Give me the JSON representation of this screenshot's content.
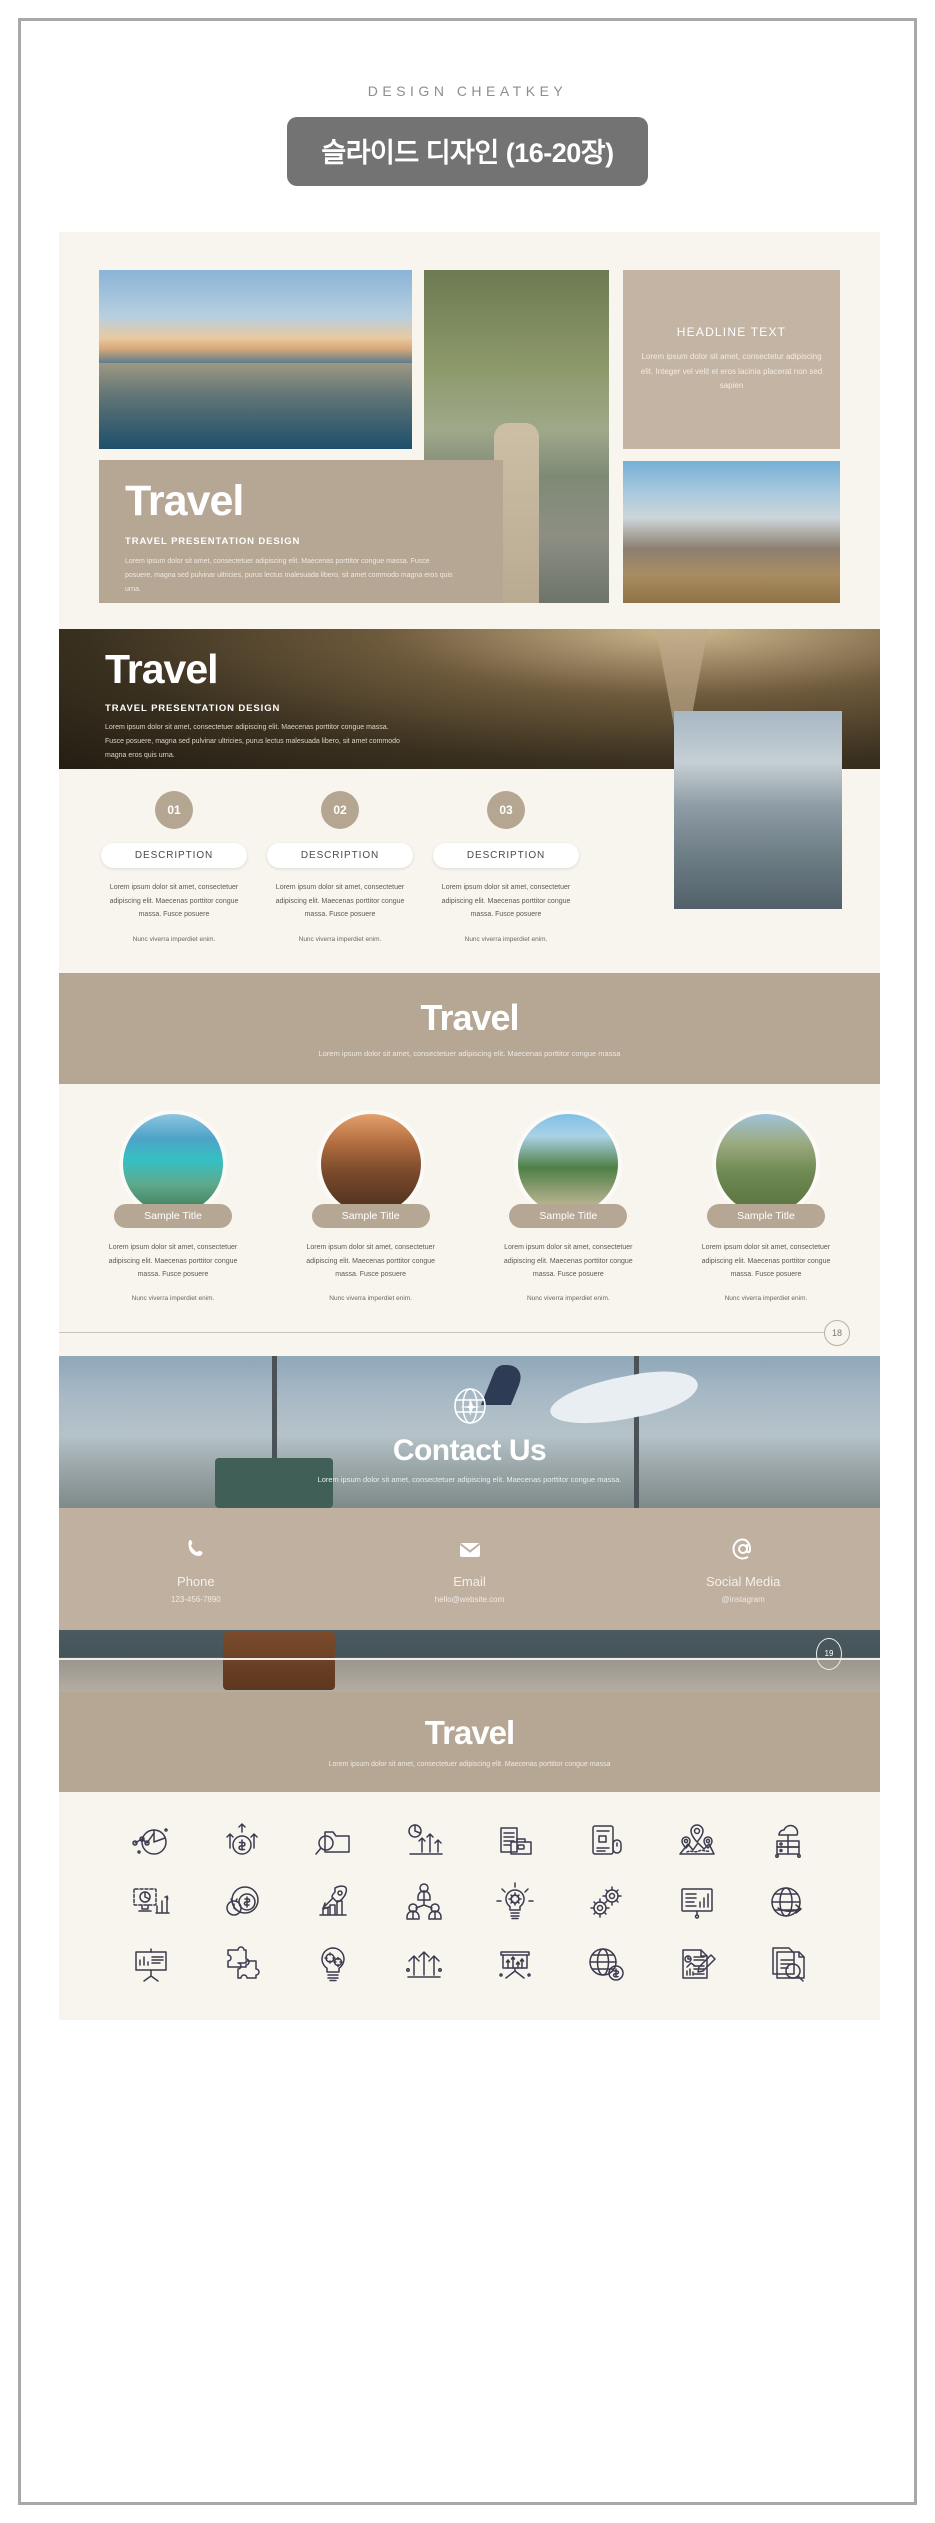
{
  "header": {
    "eyebrow": "DESIGN CHEATKEY",
    "title": "슬라이드 디자인 (16-20장)"
  },
  "slide1": {
    "headline_box": {
      "title": "HEADLINE TEXT",
      "body": "Lorem ipsum dolor sit amet, consectetur adipiscing elit. Integer vel velit et eros lacinia placerat non sed sapien"
    },
    "travel_card": {
      "title": "Travel",
      "subtitle": "TRAVEL PRESENTATION DESIGN",
      "body": "Lorem ipsum dolor sit amet, consectetuer adipiscing elit. Maecenas porttitor congue massa. Fusce posuere, magna sed pulvinar ultricies, purus lectus malesuada libero, sit amet commodo magna eros quis urna."
    },
    "images": [
      "lake-sunrise-photo",
      "woman-walking-road-photo",
      "mountain-hiker-photo"
    ]
  },
  "slide2": {
    "hero": {
      "title": "Travel",
      "subtitle": "TRAVEL PRESENTATION DESIGN",
      "body": "Lorem ipsum dolor sit amet, consectetuer adipiscing elit. Maecenas porttitor congue massa. Fusce posuere, magna sed pulvinar ultricies, purus lectus malesuada libero, sit amet commodo magna eros quis urna."
    },
    "steps": [
      {
        "number": "01",
        "label": "DESCRIPTION",
        "body": "Lorem ipsum dolor sit amet, consectetuer adipiscing elit. Maecenas porttitor congue massa. Fusce posuere",
        "note": "Nunc viverra imperdiet enim."
      },
      {
        "number": "02",
        "label": "DESCRIPTION",
        "body": "Lorem ipsum dolor sit amet, consectetuer adipiscing elit. Maecenas porttitor congue massa. Fusce posuere",
        "note": "Nunc viverra imperdiet enim."
      },
      {
        "number": "03",
        "label": "DESCRIPTION",
        "body": "Lorem ipsum dolor sit amet, consectetuer adipiscing elit. Maecenas porttitor congue massa. Fusce posuere",
        "note": "Nunc viverra imperdiet enim."
      }
    ],
    "photo": "woman-with-map-photo"
  },
  "slide3": {
    "banner": {
      "title": "Travel",
      "subtitle": "Lorem ipsum dolor sit amet, consectetuer adipiscing elit. Maecenas porttitor congue massa"
    },
    "cards": [
      {
        "image": "tropical-island-photo",
        "title": "Sample Title",
        "body": "Lorem ipsum dolor sit amet, consectetuer adipiscing elit. Maecenas porttitor congue massa. Fusce posuere",
        "note": "Nunc viverra imperdiet enim."
      },
      {
        "image": "desert-road-sunset-photo",
        "title": "Sample Title",
        "body": "Lorem ipsum dolor sit amet, consectetuer adipiscing elit. Maecenas porttitor congue massa. Fusce posuere",
        "note": "Nunc viverra imperdiet enim."
      },
      {
        "image": "palm-resort-photo",
        "title": "Sample Title",
        "body": "Lorem ipsum dolor sit amet, consectetuer adipiscing elit. Maecenas porttitor congue massa. Fusce posuere",
        "note": "Nunc viverra imperdiet enim."
      },
      {
        "image": "mountain-backpacker-photo",
        "title": "Sample Title",
        "body": "Lorem ipsum dolor sit amet, consectetuer adipiscing elit. Maecenas porttitor congue massa. Fusce posuere",
        "note": "Nunc viverra imperdiet enim."
      }
    ],
    "page_number": "18"
  },
  "slide4": {
    "hero": {
      "icon": "globe-plane-icon",
      "title": "Contact Us",
      "subtitle": "Lorem ipsum dolor sit amet, consectetuer adipiscing elit. Maecenas porttitor congue massa."
    },
    "contacts": [
      {
        "icon": "phone-icon",
        "label": "Phone",
        "value": "123-456-7890"
      },
      {
        "icon": "envelope-icon",
        "label": "Email",
        "value": "hello@website.com"
      },
      {
        "icon": "at-sign-icon",
        "label": "Social Media",
        "value": "@instagram"
      }
    ],
    "page_number": "19"
  },
  "slide5": {
    "banner": {
      "title": "Travel",
      "subtitle": "Lorem ipsum dolor sit amet, consectetuer adipiscing elit. Maecenas porttitor congue massa"
    },
    "icons": [
      "pie-chart-line-icon",
      "money-growth-icon",
      "magnifier-folder-icon",
      "chart-arrows-icon",
      "documents-briefcase-icon",
      "document-mouse-icon",
      "map-pins-icon",
      "cloud-server-icon",
      "monitor-chart-icon",
      "clock-coin-icon",
      "rocket-chart-icon",
      "team-users-icon",
      "lightbulb-gear-icon",
      "gears-icon",
      "presentation-chart-icon",
      "globe-arrow-icon",
      "presentation-board-icon",
      "puzzle-icon",
      "bulb-gears-icon",
      "growth-arrows-icon",
      "easel-chart-icon",
      "globe-coin-icon",
      "report-pen-icon",
      "document-search-icon"
    ]
  },
  "colors": {
    "beige": "#b6a795",
    "cream": "#f8f5ef",
    "pill_gray": "#737373",
    "icon_navy": "#3c3a4e"
  }
}
